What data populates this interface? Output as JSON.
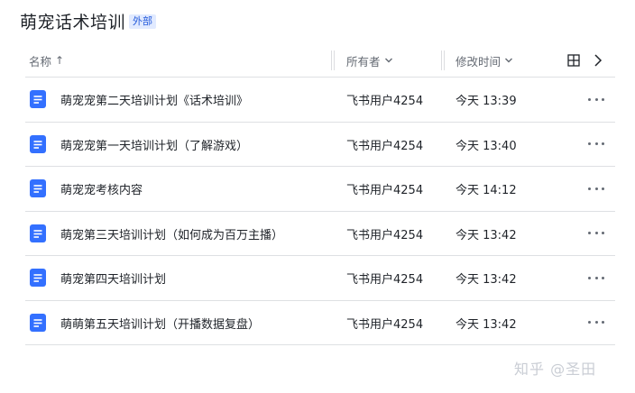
{
  "header": {
    "title": "萌宠话术培训",
    "badge": "外部"
  },
  "table": {
    "columns": {
      "name": "名称",
      "owner": "所有者",
      "modified": "修改时间"
    },
    "rows": [
      {
        "name": "萌宠宠第二天培训计划《话术培训》",
        "owner": "飞书用户4254",
        "modified": "今天 13:39"
      },
      {
        "name": "萌宠宠第一天培训计划（了解游戏）",
        "owner": "飞书用户4254",
        "modified": "今天 13:40"
      },
      {
        "name": "萌宠宠考核内容",
        "owner": "飞书用户4254",
        "modified": "今天 14:12"
      },
      {
        "name": "萌宠第三天培训计划（如何成为百万主播）",
        "owner": "飞书用户4254",
        "modified": "今天 13:42"
      },
      {
        "name": "萌宠第四天培训计划",
        "owner": "飞书用户4254",
        "modified": "今天 13:42"
      },
      {
        "name": "萌萌第五天培训计划（开播数据复盘）",
        "owner": "飞书用户4254",
        "modified": "今天 13:42"
      }
    ]
  },
  "watermark": "知乎 @圣田",
  "colors": {
    "doc_icon": "#3370ff",
    "badge_text": "#245bdb",
    "badge_bg": "#e1eaff"
  },
  "icons": {
    "sort": "arrow-up-icon",
    "dropdown": "chevron-down-icon",
    "view": "grid-view-icon",
    "next": "chevron-right-icon",
    "file": "doc-icon",
    "more": "more-icon"
  }
}
